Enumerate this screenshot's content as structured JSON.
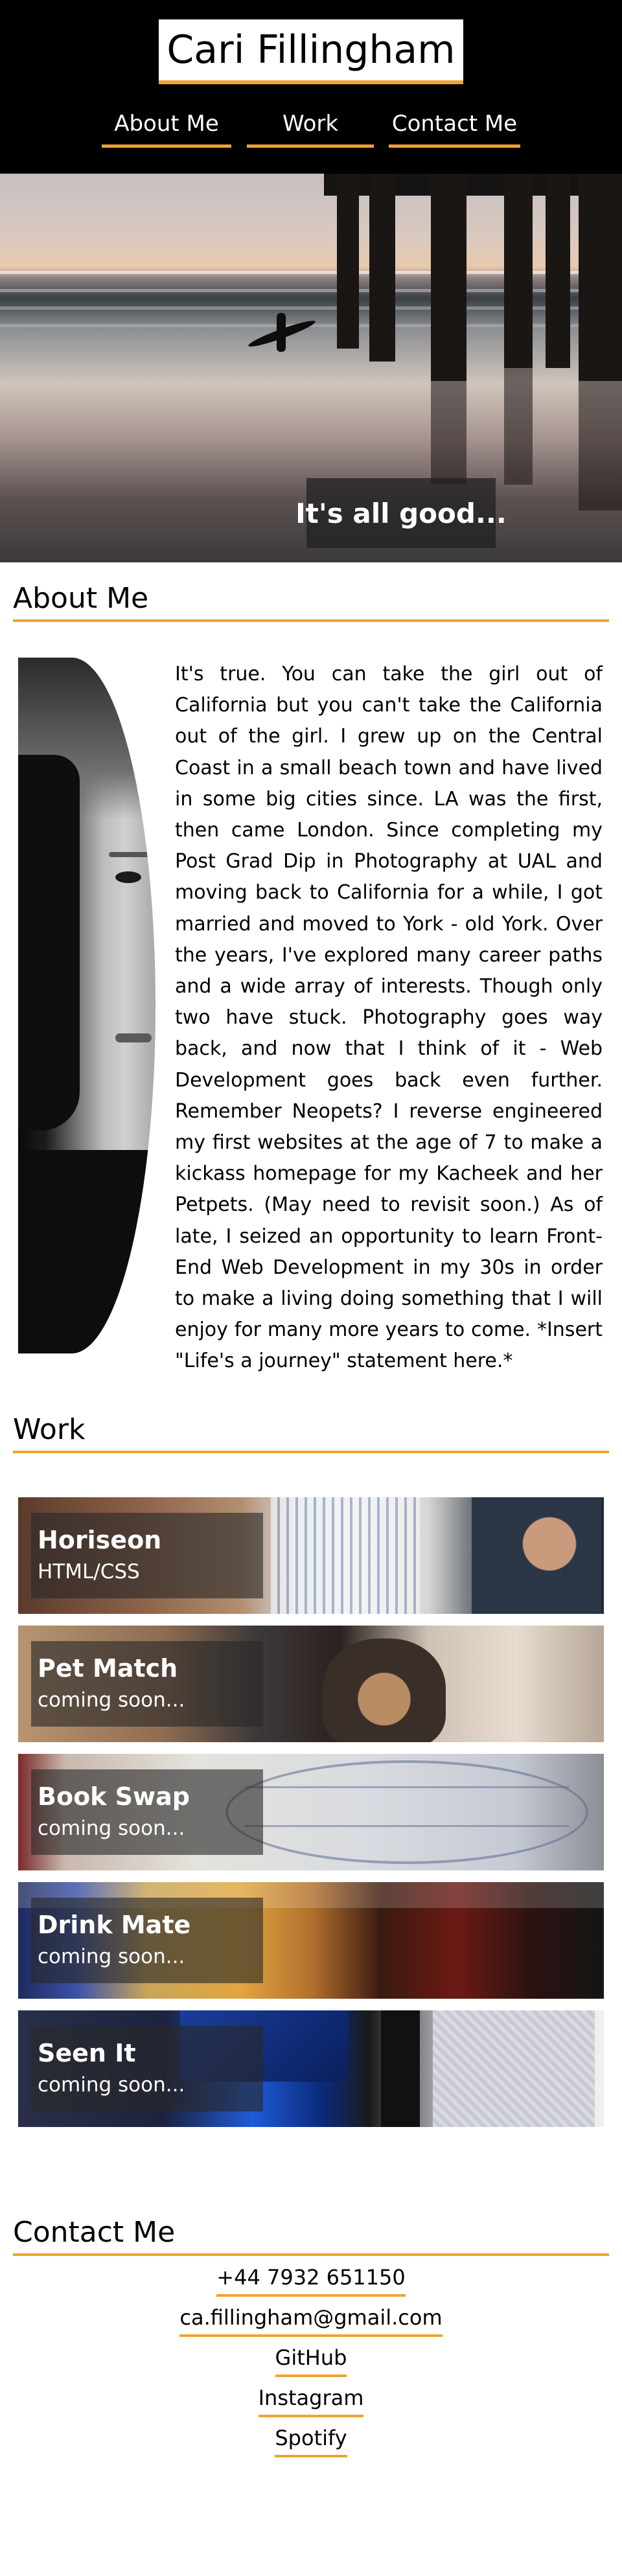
{
  "header": {
    "brand": "Cari Fillingham",
    "nav": [
      "About Me",
      "Work",
      "Contact Me"
    ]
  },
  "hero": {
    "tagline": "It's all good..."
  },
  "about": {
    "heading": "About Me",
    "text": "It's true. You can take the girl out of California but you can't take the California out of the girl. I grew up on the Central Coast in a small beach town and have lived in some big cities since. LA was the first, then came London. Since completing my Post Grad Dip in Photography at UAL and moving back to California for a while, I got married and moved to York - old York. Over the years, I've explored many career paths and a wide array of interests. Though only two have stuck. Photography goes way back, and now that I think of it - Web Development goes back even further. Remember Neopets? I reverse engineered my first websites at the age of 7 to make a kickass homepage for my Kacheek and her Petpets. (May need to revisit soon.) As of late, I seized an opportunity to learn Front-End Web Development in my 30s in order to make a living doing something that I will enjoy for many more years to come. *Insert \"Life's a journey\" statement here.*"
  },
  "work": {
    "heading": "Work",
    "projects": [
      {
        "title": "Horiseon",
        "subtitle": "HTML/CSS"
      },
      {
        "title": "Pet Match",
        "subtitle": "coming soon..."
      },
      {
        "title": "Book Swap",
        "subtitle": "coming soon..."
      },
      {
        "title": "Drink Mate",
        "subtitle": "coming soon..."
      },
      {
        "title": "Seen It",
        "subtitle": "coming soon..."
      }
    ]
  },
  "contact": {
    "heading": "Contact Me",
    "links": [
      "+44 7932 651150",
      "ca.fillingham@gmail.com",
      "GitHub",
      "Instagram",
      "Spotify"
    ]
  },
  "colors": {
    "accent": "#f0a330",
    "header_bg": "#000000"
  }
}
